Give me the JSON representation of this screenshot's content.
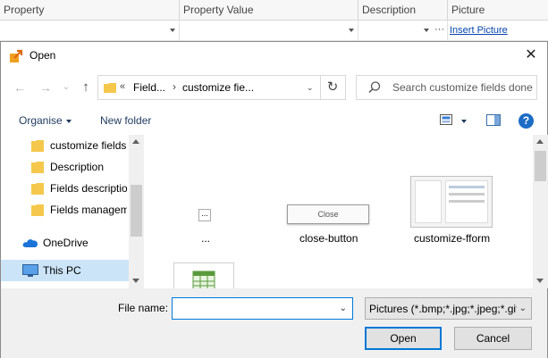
{
  "grid": {
    "columns": [
      "Property",
      "Property Value",
      "Description",
      "Picture"
    ],
    "ellipsis": "···",
    "insert_picture": "Insert Picture"
  },
  "dialog": {
    "title": "Open",
    "close_glyph": "✕",
    "nav": {
      "back_glyph": "←",
      "forward_glyph": "→",
      "recent_glyph": "⌄",
      "up_glyph": "↑"
    },
    "address": {
      "overflow": "«",
      "segment1": "Field...",
      "separator": "›",
      "segment2": "customize fie...",
      "chevron": "⌄",
      "refresh_glyph": "↻"
    },
    "search": {
      "placeholder": "Search customize fields done"
    },
    "toolbar": {
      "organise": "Organise",
      "new_folder": "New folder",
      "help": "?"
    },
    "nav_pane": {
      "folders": [
        "customize fields",
        "Description",
        "Fields description",
        "Fields management"
      ],
      "onedrive": "OneDrive",
      "thispc": "This PC"
    },
    "files": [
      {
        "label": "...",
        "thumb_text": "..."
      },
      {
        "label": "close-button",
        "thumb_text": "Close"
      },
      {
        "label": "customize-fform"
      }
    ],
    "bottom": {
      "file_name_label": "File name:",
      "file_name_value": "",
      "filter": "Pictures (*.bmp;*.jpg;*.jpeg;*.gif)",
      "dropdown_glyph": "⌄",
      "open": "Open",
      "cancel": "Cancel"
    }
  },
  "colors": {
    "accent": "#0078d7",
    "selection": "#cce4f7",
    "folder": "#f5c84c",
    "help": "#1c6cc6",
    "link": "#0645ad"
  }
}
